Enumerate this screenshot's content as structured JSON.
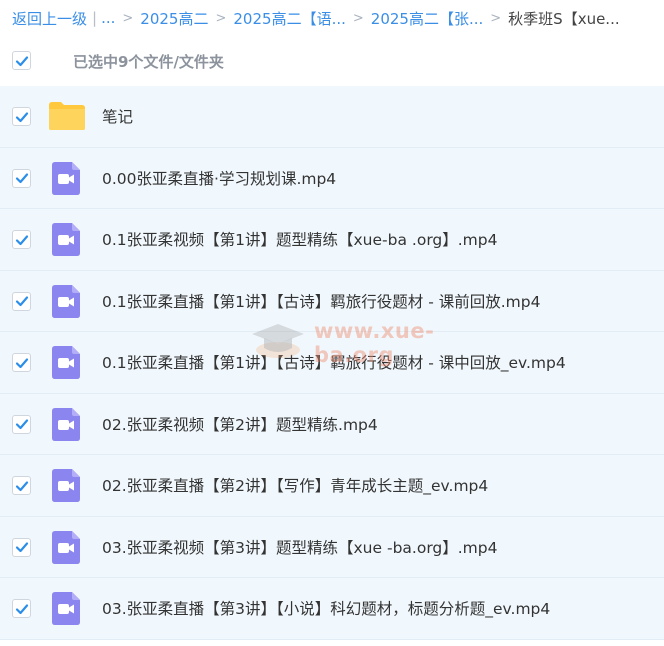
{
  "breadcrumb": {
    "back_label": "返回上一级",
    "ellipsis": "...",
    "items": [
      "2025高二",
      "2025高二【语...",
      "2025高二【张..."
    ],
    "current": "秋季班S【xue..."
  },
  "selection": {
    "summary": "已选中9个文件/文件夹"
  },
  "files": [
    {
      "name": "笔记",
      "type": "folder"
    },
    {
      "name": "0.00张亚柔直播·学习规划课.mp4",
      "type": "video"
    },
    {
      "name": "0.1张亚柔视频【第1讲】题型精练【xue-ba .org】.mp4",
      "type": "video"
    },
    {
      "name": "0.1张亚柔直播【第1讲】【古诗】羁旅行役题材 - 课前回放.mp4",
      "type": "video"
    },
    {
      "name": "0.1张亚柔直播【第1讲】【古诗】羁旅行役题材 - 课中回放_ev.mp4",
      "type": "video"
    },
    {
      "name": "02.张亚柔视频【第2讲】题型精练.mp4",
      "type": "video"
    },
    {
      "name": "02.张亚柔直播【第2讲】【写作】青年成长主题_ev.mp4",
      "type": "video"
    },
    {
      "name": "03.张亚柔视频【第3讲】题型精练【xue -ba.org】.mp4",
      "type": "video"
    },
    {
      "name": "03.张亚柔直播【第3讲】【小说】科幻题材，标题分析题_ev.mp4",
      "type": "video"
    }
  ],
  "watermark": "www.xue-ba.org",
  "colors": {
    "link": "#3a8ee6",
    "check": "#2b8ee8",
    "row_bg": "#f1f8fd",
    "video_icon": "#8b85f0",
    "folder": "#ffc83d"
  },
  "icons": {
    "checkbox": "checkmark-icon",
    "folder": "folder-icon",
    "video": "video-file-icon"
  }
}
